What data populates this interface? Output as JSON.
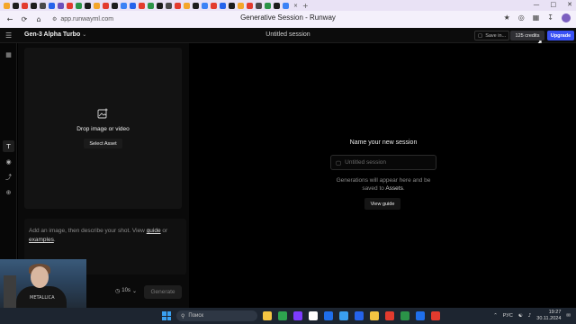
{
  "browser": {
    "tab_colors": [
      "#f4a62a",
      "#1c1c1c",
      "#e33b2e",
      "#1c1c1c",
      "#4a4a4a",
      "#2563eb",
      "#6b4fbb",
      "#e33b2e",
      "#2b9348",
      "#1c1c1c",
      "#f4a62a",
      "#e33b2e",
      "#1c1c1c",
      "#3b82f6",
      "#2563eb",
      "#e33b2e",
      "#2b9348",
      "#1c1c1c",
      "#4a4a4a",
      "#e33b2e",
      "#f4a62a",
      "#1c1c1c",
      "#3b82f6",
      "#e33b2e",
      "#2563eb",
      "#1c1c1c",
      "#f4a62a",
      "#e33b2e",
      "#4a4a4a",
      "#2b9348",
      "#1c1c1c",
      "#3b82f6"
    ],
    "url": "app.runwayml.com",
    "page_title": "Generative Session - Runway"
  },
  "header": {
    "model": "Gen-3 Alpha Turbo",
    "session_title": "Untitled session",
    "save_label": "Save in...",
    "credits_label": "125 credits",
    "upgrade_label": "Upgrade",
    "upgrade_color": "#3a52f5"
  },
  "left_panel": {
    "drop_label": "Drop image or video",
    "select_asset_label": "Select Asset",
    "prompt": {
      "part1": "Add an image, then describe your shot. View ",
      "guide_link": "guide",
      "part2": " or ",
      "examples_link": "examples",
      "part3": "."
    },
    "duration": "10s",
    "generate_label": "Generate"
  },
  "webcam": {
    "shirt_text": "METALLICA"
  },
  "main": {
    "empty_title": "Name your new session",
    "session_placeholder": "Untitled session",
    "desc_part1": "Generations will appear here and be saved to ",
    "assets_link": "Assets",
    "desc_part2": ".",
    "view_guide_label": "View guide"
  },
  "taskbar": {
    "search_placeholder": "Поиск",
    "language": "РУС",
    "time": "19:27",
    "date": "30.11.2024",
    "app_colors": [
      "#f4c542",
      "#2ea44f",
      "#7d3cff",
      "#ffffff",
      "#1f6feb",
      "#3aa0f0",
      "#2563eb",
      "#f4c542",
      "#e33b2e",
      "#2b9348",
      "#1f6feb",
      "#e33b2e"
    ]
  }
}
